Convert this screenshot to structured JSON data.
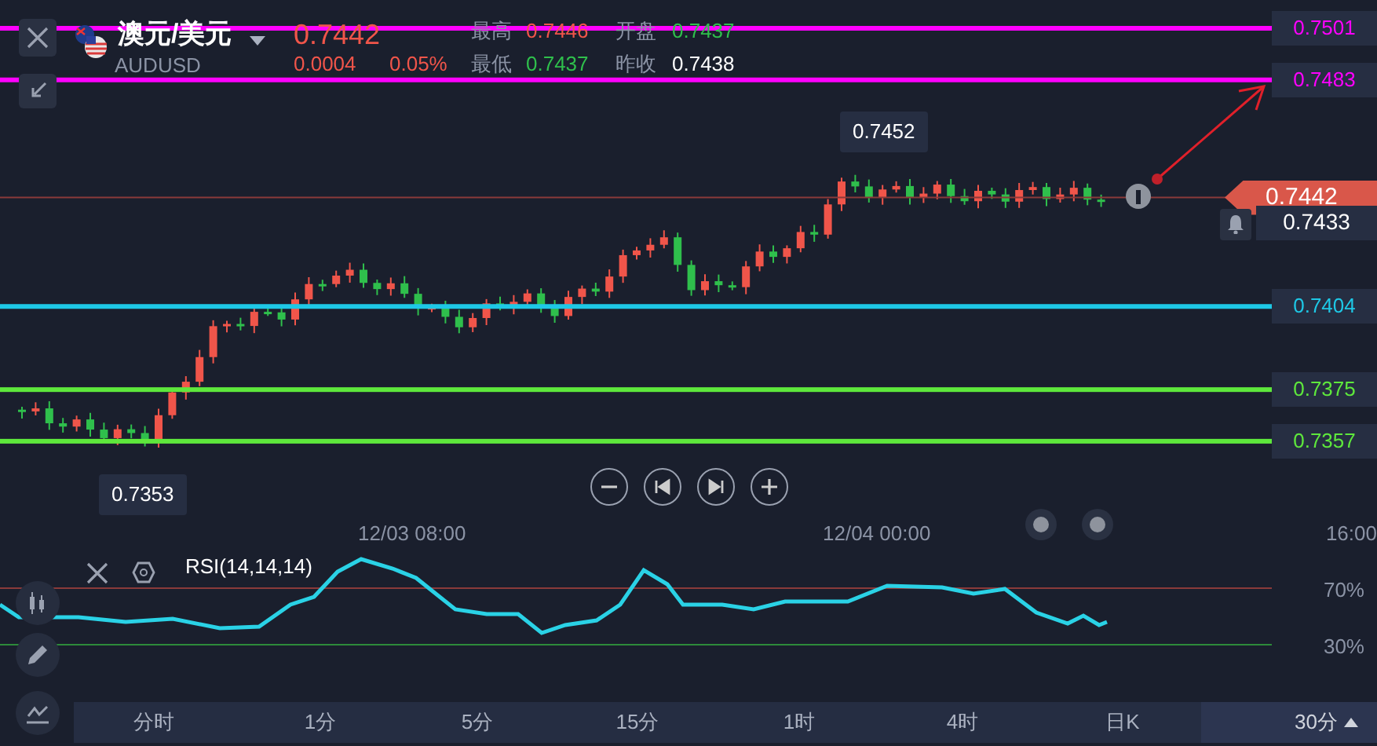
{
  "header": {
    "pair": "澳元/美元",
    "symbol": "AUDUSD",
    "price": "0.7442",
    "change": "0.0004",
    "change_percent": "0.05%",
    "stats": [
      {
        "label": "最高",
        "value": "0.7446",
        "color": "#f0554a"
      },
      {
        "label": "开盘",
        "value": "0.7437",
        "color": "#2fbf4c"
      },
      {
        "label": "最低",
        "value": "0.7437",
        "color": "#2fbf4c"
      },
      {
        "label": "昨收",
        "value": "0.7438",
        "color": "#ffffff"
      }
    ]
  },
  "price_lines": [
    {
      "value": "0.7501",
      "color": "#ff00ff"
    },
    {
      "value": "0.7483",
      "color": "#ff00ff"
    },
    {
      "value": "0.7404",
      "color": "#1ec8e6"
    },
    {
      "value": "0.7375",
      "color": "#5ee83c"
    },
    {
      "value": "0.7357",
      "color": "#5ee83c"
    }
  ],
  "current_price": "0.7442",
  "alert_price": "0.7433",
  "high_marker": "0.7452",
  "low_marker": "0.7353",
  "time_axis": [
    "12/03 08:00",
    "12/04 00:00",
    "16:00"
  ],
  "indicator": {
    "label": "RSI(14,14,14)",
    "levels": [
      "70%",
      "30%"
    ]
  },
  "timeframes": [
    {
      "label": "分时",
      "selected": false
    },
    {
      "label": "1分",
      "selected": false
    },
    {
      "label": "5分",
      "selected": false
    },
    {
      "label": "15分",
      "selected": false
    },
    {
      "label": "1时",
      "selected": false
    },
    {
      "label": "4时",
      "selected": false
    },
    {
      "label": "日K",
      "selected": false
    }
  ],
  "current_timeframe": "30分"
}
